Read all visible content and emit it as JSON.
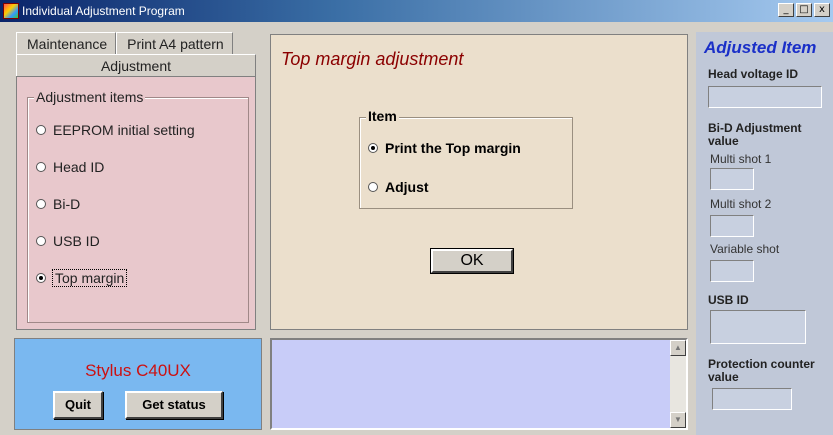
{
  "window": {
    "title": "Individual Adjustment Program",
    "controls": [
      "_",
      "□",
      "x"
    ]
  },
  "tabs": {
    "items": [
      "Maintenance",
      "Print A4 pattern"
    ],
    "active": "Adjustment"
  },
  "adjustment_items": {
    "legend": "Adjustment items",
    "options": [
      {
        "label": "EEPROM initial setting",
        "checked": false
      },
      {
        "label": "Head ID",
        "checked": false
      },
      {
        "label": "Bi-D",
        "checked": false
      },
      {
        "label": "USB ID",
        "checked": false
      },
      {
        "label": "Top margin",
        "checked": true
      }
    ]
  },
  "status": {
    "model": "Stylus C40UX",
    "quit_label": "Quit",
    "get_status_label": "Get status"
  },
  "main": {
    "title": "Top margin adjustment",
    "item_legend": "Item",
    "options": [
      {
        "label": "Print the Top margin",
        "checked": true
      },
      {
        "label": "Adjust",
        "checked": false
      }
    ],
    "ok_label": "OK"
  },
  "log": {
    "text": ""
  },
  "adjusted": {
    "title": "Adjusted Item",
    "head_voltage_label": "Head voltage ID",
    "bid_label": "Bi-D Adjustment value",
    "multi_shot_1": "Multi shot 1",
    "multi_shot_2": "Multi shot 2",
    "variable_shot": "Variable shot",
    "usb_id_label": "USB ID",
    "protection_label": "Protection counter value"
  },
  "colors": {
    "title_bar": "#0a246a",
    "adjust_panel": "#e8c8cc",
    "status_panel": "#7ab8f0",
    "main_panel": "#ebdfcc",
    "model_text": "#cc1111",
    "main_title": "#8b0000",
    "adjusted_title": "#1a2fc8"
  }
}
